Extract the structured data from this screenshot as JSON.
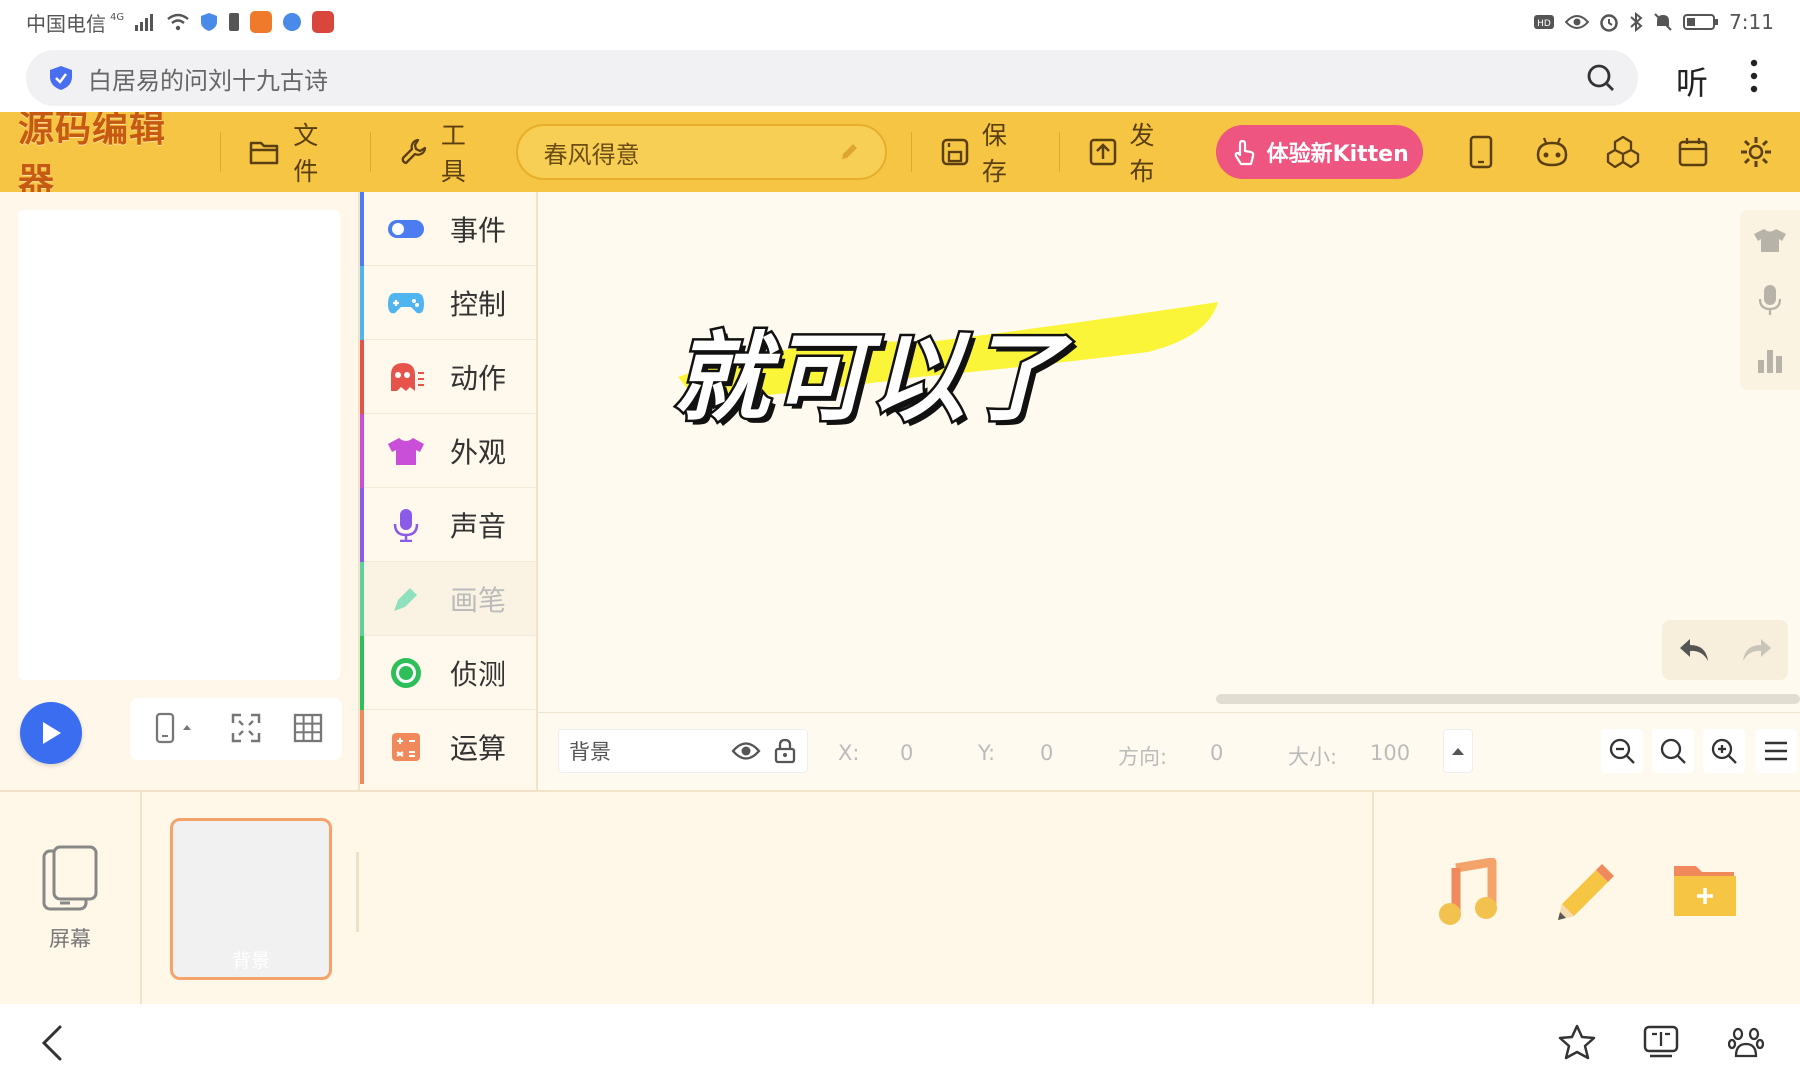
{
  "status_bar": {
    "carrier": "中国电信",
    "network": "4G",
    "time": "7:11",
    "indicators": [
      "hd-icon",
      "eye-icon",
      "alarm-icon",
      "bluetooth-icon",
      "mute-icon",
      "battery-icon"
    ]
  },
  "browser": {
    "url_text": "白居易的问刘十九古诗",
    "listen_label": "听"
  },
  "toolbar": {
    "logo": "源码编辑器",
    "file_label": "文件",
    "tools_label": "工具",
    "project_name": "春风得意",
    "save_label": "保存",
    "publish_label": "发布",
    "kitten_label": "体验新Kitten"
  },
  "palette": {
    "categories": [
      {
        "label": "事件",
        "color": "#4c7cf0"
      },
      {
        "label": "控制",
        "color": "#4fb4f0"
      },
      {
        "label": "动作",
        "color": "#e5534b"
      },
      {
        "label": "外观",
        "color": "#c94fd8"
      },
      {
        "label": "声音",
        "color": "#8a5ae8"
      },
      {
        "label": "画笔",
        "color": "#5fd1a0"
      },
      {
        "label": "侦测",
        "color": "#2fbf5a"
      },
      {
        "label": "运算",
        "color": "#f08a5d"
      }
    ]
  },
  "caption": "就可以了",
  "property_bar": {
    "sprite_name": "背景",
    "x_label": "X:",
    "x_value": "0",
    "y_label": "Y:",
    "y_value": "0",
    "direction_label": "方向:",
    "direction_value": "0",
    "size_label": "大小:",
    "size_value": "100"
  },
  "drawer": {
    "screen_label": "屏幕",
    "background_label": "背景"
  },
  "colors": {
    "toolbar": "#f6c543",
    "accent_pink": "#ee5580",
    "play_blue": "#3b6df0",
    "caption_highlight": "#fbf53a"
  }
}
